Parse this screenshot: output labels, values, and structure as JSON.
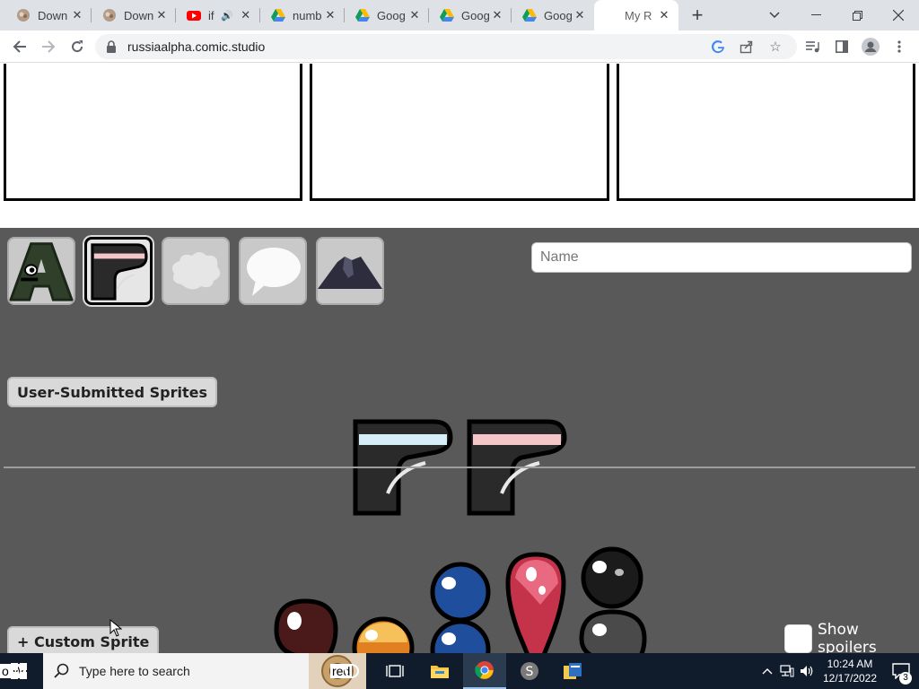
{
  "browser": {
    "tabs": [
      {
        "title": "Down",
        "icon": "roblox-icon"
      },
      {
        "title": "Down",
        "icon": "roblox-icon"
      },
      {
        "title": "if",
        "icon": "youtube-icon",
        "audio": true
      },
      {
        "title": "numb",
        "icon": "google-drive-icon"
      },
      {
        "title": "Goog",
        "icon": "google-drive-icon"
      },
      {
        "title": "Goog",
        "icon": "google-drive-icon"
      },
      {
        "title": "Goog",
        "icon": "google-drive-icon"
      },
      {
        "title": "My R",
        "icon": "",
        "active": true
      }
    ],
    "url": "russiaalpha.comic.studio"
  },
  "editor": {
    "name_placeholder": "Name",
    "user_sprites_label": "User-Submitted Sprites",
    "custom_sprite_label": "+ Custom Sprite",
    "show_spoilers_label": "Show spoilers",
    "colors": {
      "background": "#595959",
      "divider": "#9d9d9d"
    },
    "tool_tiles": [
      "letter-a-character-icon",
      "letter-r-character-icon",
      "thought-bubble-icon",
      "speech-bubble-icon",
      "volcano-backdrop-icon"
    ],
    "sprites_top": [
      "r-sprite-blue-stripe",
      "r-sprite-pink-stripe"
    ],
    "sprites_bottom": [
      "comma-sprite",
      "period-sprite",
      "colon-sprite",
      "exclamation-sprite",
      "semicolon-sprite"
    ]
  },
  "taskbar": {
    "search_placeholder": "Type here to search",
    "clock_time": "10:24 AM",
    "clock_date": "12/17/2022",
    "notification_count": "3",
    "peek_left": "o W",
    "peek_right": "red"
  }
}
